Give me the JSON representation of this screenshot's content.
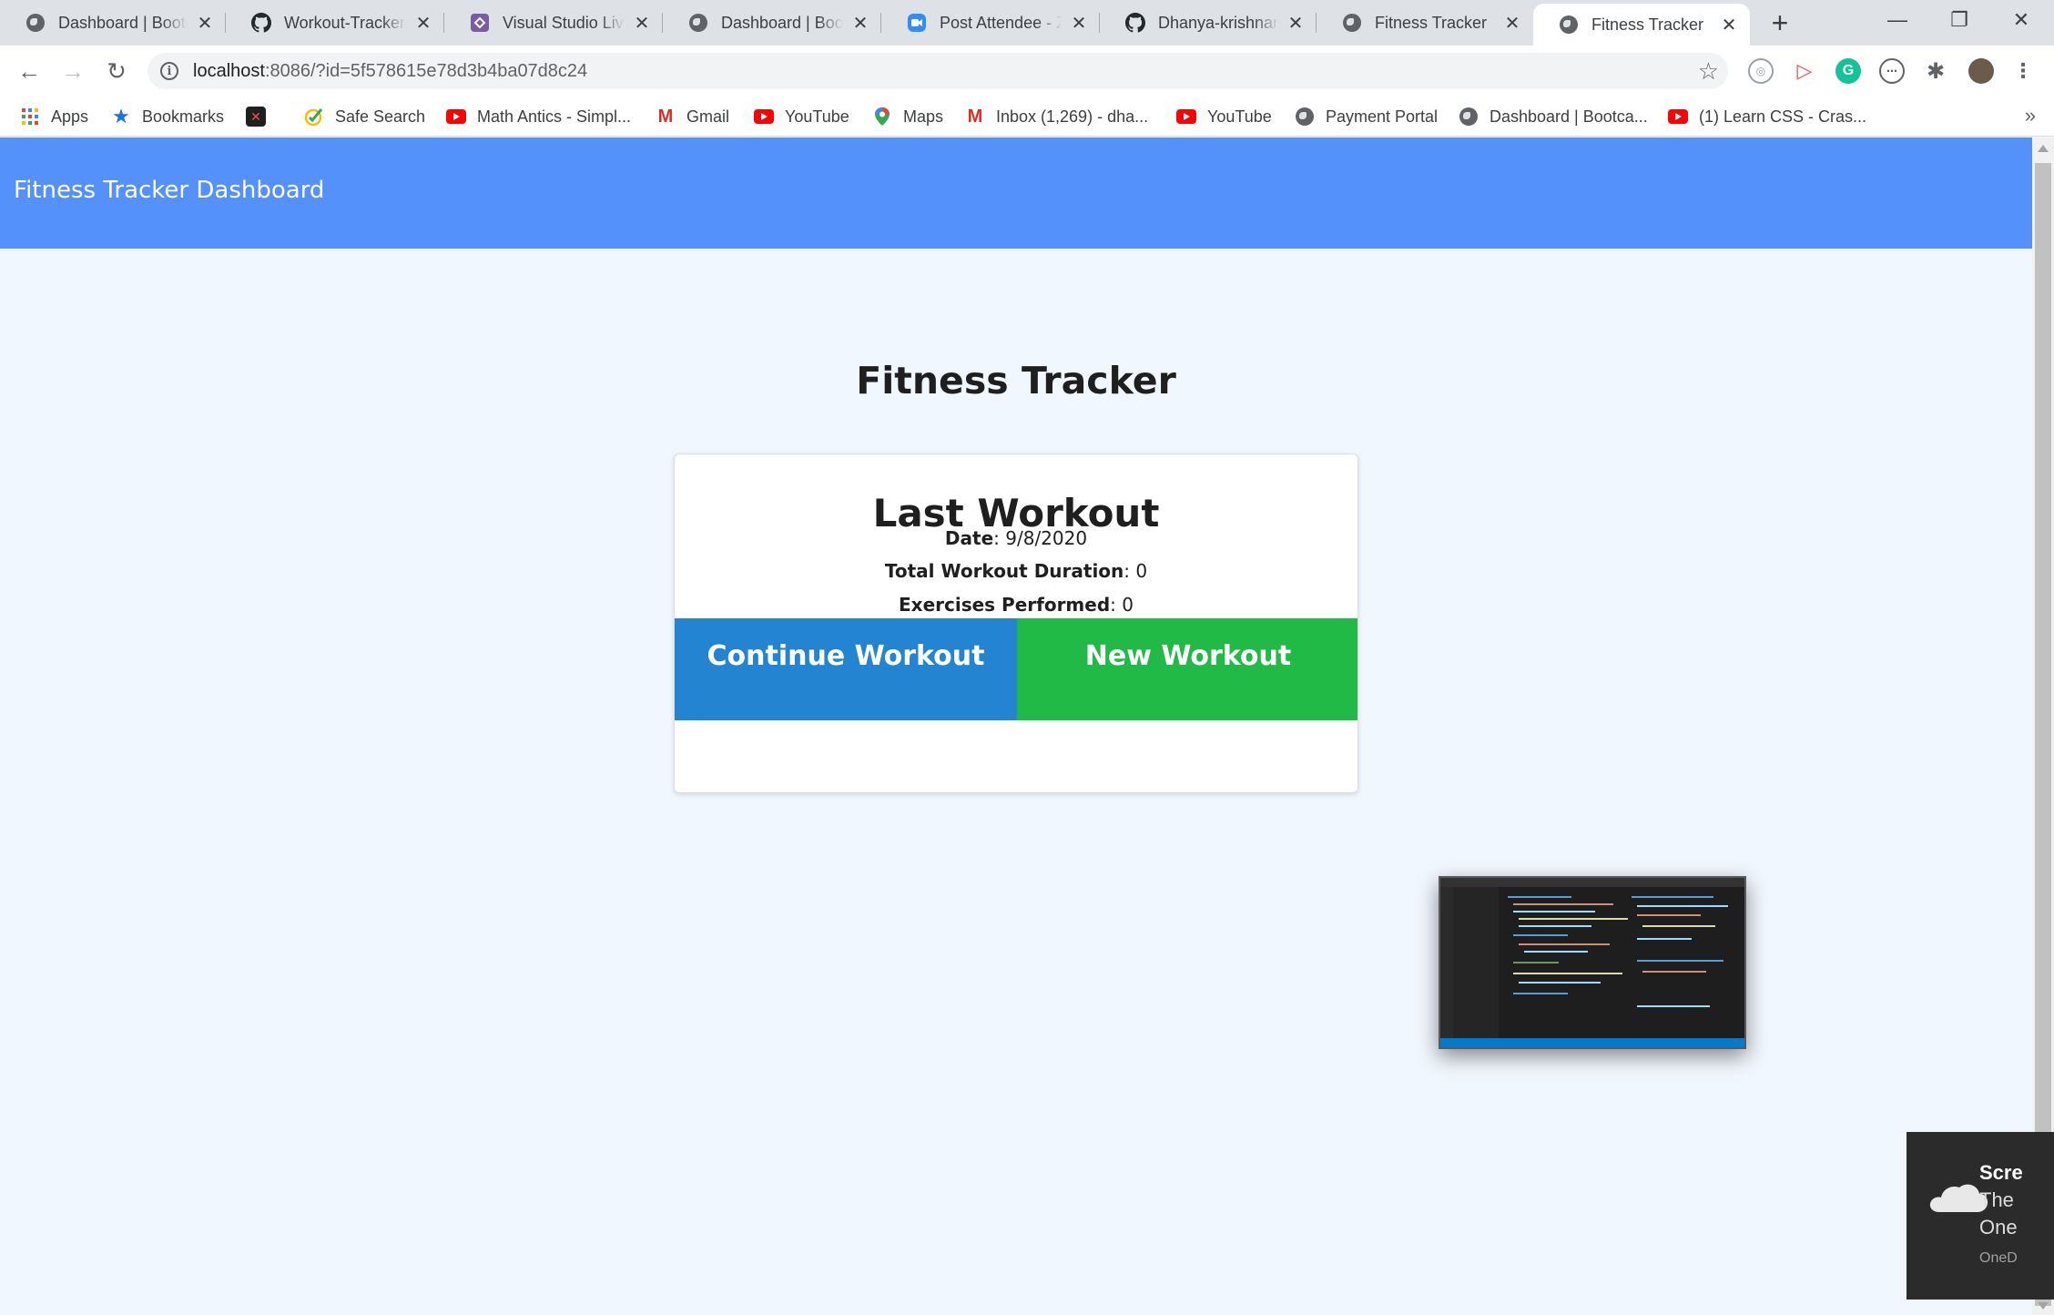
{
  "browser": {
    "tabs": [
      {
        "title": "Dashboard | Bootcamp",
        "icon": "globe-icon"
      },
      {
        "title": "Workout-Tracker/",
        "icon": "github-icon"
      },
      {
        "title": "Visual Studio Live Share",
        "icon": "liveshare-icon"
      },
      {
        "title": "Dashboard | Bootcamp",
        "icon": "globe-icon"
      },
      {
        "title": "Post Attendee - Zoom",
        "icon": "zoom-icon"
      },
      {
        "title": "Dhanya-krishnan2",
        "icon": "github-icon"
      },
      {
        "title": "Fitness Tracker",
        "icon": "globe-icon"
      },
      {
        "title": "Fitness Tracker",
        "icon": "globe-icon",
        "active": true
      }
    ],
    "url_host": "localhost",
    "url_rest": ":8086/?id=5f578615e78d3b4ba07d8c24",
    "bookmarks": [
      {
        "label": "Apps",
        "icon": "apps-grid-icon"
      },
      {
        "label": "Bookmarks",
        "icon": "star-icon"
      },
      {
        "label": "",
        "icon": "app-logo-icon"
      },
      {
        "label": "Safe Search",
        "icon": "safe-search-icon"
      },
      {
        "label": "Math Antics - Simpl...",
        "icon": "youtube-icon"
      },
      {
        "label": "Gmail",
        "icon": "gmail-icon"
      },
      {
        "label": "YouTube",
        "icon": "youtube-icon"
      },
      {
        "label": "Maps",
        "icon": "maps-icon"
      },
      {
        "label": "Inbox (1,269) - dha...",
        "icon": "gmail-icon"
      },
      {
        "label": "YouTube",
        "icon": "youtube-icon"
      },
      {
        "label": "Payment Portal",
        "icon": "globe-icon"
      },
      {
        "label": "Dashboard | Bootca...",
        "icon": "globe-icon"
      },
      {
        "label": "(1) Learn CSS - Cras...",
        "icon": "youtube-icon"
      }
    ],
    "more_bookmarks": "»"
  },
  "app": {
    "nav_brand": "Fitness Tracker Dashboard",
    "page_title": "Fitness Tracker",
    "card": {
      "heading": "Last Workout",
      "date_label": "Date",
      "date_value": ": 9/8/2020",
      "duration_label": "Total Workout Duration",
      "duration_value": ": 0",
      "exercises_label": "Exercises Performed",
      "exercises_value": ": 0",
      "continue_button": "Continue Workout",
      "new_button": "New Workout"
    },
    "colors": {
      "navbar": "#5491fa",
      "continue": "#2384d1",
      "new": "#22ba46",
      "page_bg": "#f1f7fe"
    }
  },
  "toast": {
    "title": "Scre",
    "line1": "The",
    "line2": "One",
    "footer": "OneD"
  }
}
